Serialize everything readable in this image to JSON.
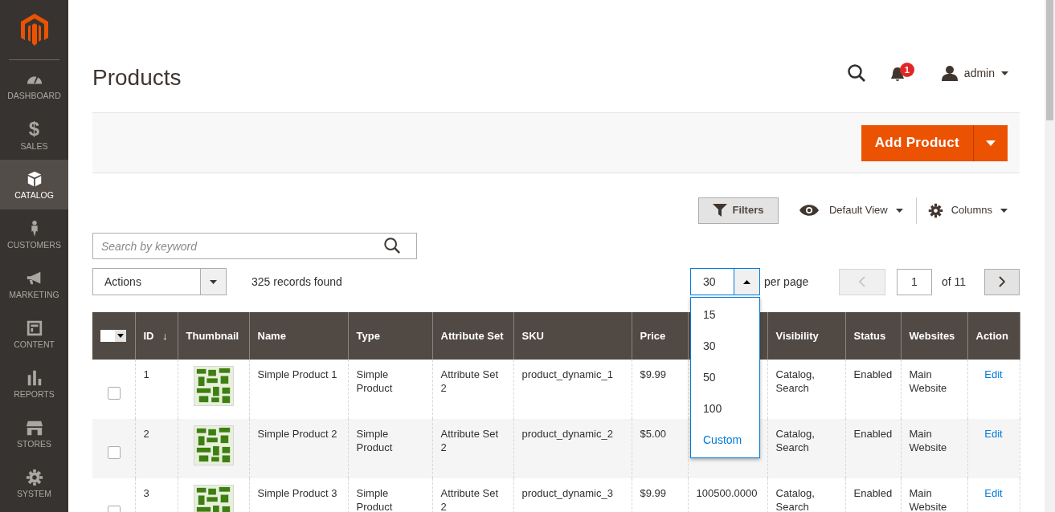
{
  "sidebar": {
    "items": [
      {
        "kind": "dashboard",
        "label": "DASHBOARD",
        "selected": false
      },
      {
        "kind": "sales",
        "glyph": "$",
        "label": "SALES",
        "selected": false
      },
      {
        "kind": "catalog",
        "label": "CATALOG",
        "selected": true
      },
      {
        "kind": "customers",
        "label": "CUSTOMERS",
        "selected": false
      },
      {
        "kind": "marketing",
        "label": "MARKETING",
        "selected": false
      },
      {
        "kind": "content",
        "label": "CONTENT",
        "selected": false
      },
      {
        "kind": "reports",
        "label": "REPORTS",
        "selected": false
      },
      {
        "kind": "stores",
        "label": "STORES",
        "selected": false
      },
      {
        "kind": "system",
        "label": "SYSTEM",
        "selected": false
      }
    ]
  },
  "page_title": "Products",
  "header": {
    "notifications_count": "1",
    "user": "admin"
  },
  "add_button": {
    "label": "Add Product"
  },
  "toolbar": {
    "filters": "Filters",
    "view": "Default View",
    "columns": "Columns"
  },
  "search": {
    "placeholder": "Search by keyword"
  },
  "actions": {
    "label": "Actions"
  },
  "records_found": "325 records found",
  "per_page": {
    "value": "30",
    "expanded": true,
    "label": "per page",
    "options": [
      {
        "label": "15",
        "kind": "number"
      },
      {
        "label": "30",
        "kind": "number"
      },
      {
        "label": "50",
        "kind": "number"
      },
      {
        "label": "100",
        "kind": "number"
      },
      {
        "label": "Custom",
        "kind": "custom"
      }
    ]
  },
  "pager": {
    "prev_disabled": true,
    "page": "1",
    "total": "of 11"
  },
  "table": {
    "columns": [
      {
        "label": "ID",
        "sort_mark": "↓"
      },
      {
        "label": "Thumbnail"
      },
      {
        "label": "Name"
      },
      {
        "label": "Type"
      },
      {
        "label": "Attribute Set"
      },
      {
        "label": "SKU"
      },
      {
        "label": "Price"
      },
      null,
      {
        "label": "Visibility"
      },
      {
        "label": "Status"
      },
      {
        "label": "Websites"
      },
      {
        "label": "Action"
      }
    ],
    "rows": [
      {
        "checked": false,
        "id": "1",
        "name": "Simple Product 1",
        "type": "Simple Product",
        "attribute_set": "Attribute Set 2",
        "sku": "product_dynamic_1",
        "price": "$9.99",
        "visibility": "Catalog, Search",
        "status": "Enabled",
        "websites": "Main Website",
        "action": "Edit"
      },
      {
        "checked": false,
        "id": "2",
        "name": "Simple Product 2",
        "type": "Simple Product",
        "attribute_set": "Attribute Set 2",
        "sku": "product_dynamic_2",
        "price": "$5.00",
        "visibility": "Catalog, Search",
        "status": "Enabled",
        "websites": "Main Website",
        "action": "Edit"
      },
      {
        "checked": false,
        "id": "3",
        "name": "Simple Product 3",
        "type": "Simple Product",
        "attribute_set": "Attribute Set 2",
        "sku": "product_dynamic_3",
        "price": "$9.99",
        "column_8": "100500.0000",
        "visibility": "Catalog, Search",
        "status": "Enabled",
        "websites": "Main Website",
        "action": "Edit"
      }
    ]
  }
}
